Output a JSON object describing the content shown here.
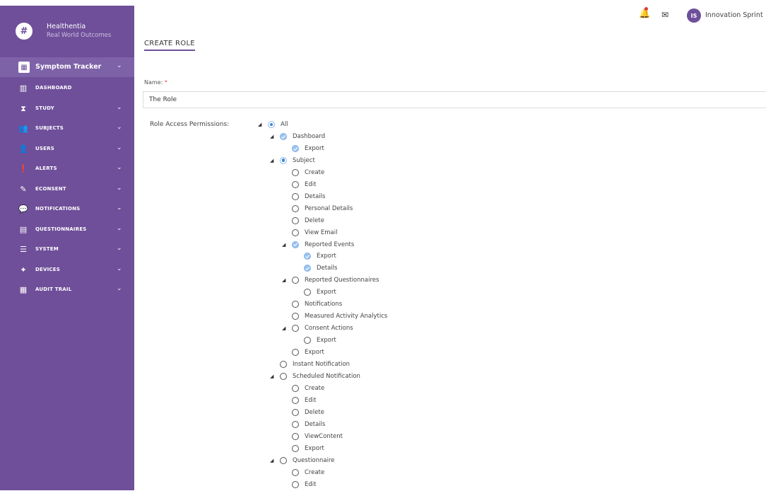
{
  "sidebar": {
    "brand_logo": "#",
    "brand_name": "Healthentia",
    "brand_sub": "Real World Outcomes",
    "module": {
      "label": "Symptom Tracker",
      "icon": "grid-icon"
    },
    "items": [
      {
        "label": "DASHBOARD",
        "icon": "bar-chart-icon",
        "chevron": false
      },
      {
        "label": "STUDY",
        "icon": "hourglass-icon",
        "chevron": true
      },
      {
        "label": "SUBJECTS",
        "icon": "users-icon",
        "chevron": true
      },
      {
        "label": "USERS",
        "icon": "user-icon",
        "chevron": true
      },
      {
        "label": "ALERTS",
        "icon": "alert-icon",
        "chevron": true
      },
      {
        "label": "ECONSENT",
        "icon": "pencil-icon",
        "chevron": true
      },
      {
        "label": "NOTIFICATIONS",
        "icon": "chat-icon",
        "chevron": true
      },
      {
        "label": "QUESTIONNAIRES",
        "icon": "clipboard-icon",
        "chevron": true
      },
      {
        "label": "SYSTEM",
        "icon": "sliders-icon",
        "chevron": true
      },
      {
        "label": "DEVICES",
        "icon": "plug-icon",
        "chevron": true
      },
      {
        "label": "AUDIT TRAIL",
        "icon": "audit-icon",
        "chevron": true
      }
    ]
  },
  "header": {
    "user_initials": "IS",
    "user_name": "Innovation Sprint"
  },
  "main": {
    "title": "CREATE ROLE",
    "name_label": "Name:",
    "name_required": "*",
    "name_value": "The Role",
    "permissions_label": "Role Access Permissions:"
  },
  "tree": [
    {
      "label": "All",
      "level": 0,
      "state": "partial",
      "expandable": true
    },
    {
      "label": "Dashboard",
      "level": 1,
      "state": "checked",
      "expandable": true
    },
    {
      "label": "Export",
      "level": 2,
      "state": "checked",
      "expandable": false
    },
    {
      "label": "Subject",
      "level": 1,
      "state": "partial",
      "expandable": true
    },
    {
      "label": "Create",
      "level": 2,
      "state": "unchecked",
      "expandable": false
    },
    {
      "label": "Edit",
      "level": 2,
      "state": "unchecked",
      "expandable": false
    },
    {
      "label": "Details",
      "level": 2,
      "state": "unchecked",
      "expandable": false
    },
    {
      "label": "Personal Details",
      "level": 2,
      "state": "unchecked",
      "expandable": false
    },
    {
      "label": "Delete",
      "level": 2,
      "state": "unchecked",
      "expandable": false
    },
    {
      "label": "View Email",
      "level": 2,
      "state": "unchecked",
      "expandable": false
    },
    {
      "label": "Reported Events",
      "level": 2,
      "state": "checked",
      "expandable": true
    },
    {
      "label": "Export",
      "level": 3,
      "state": "checked",
      "expandable": false
    },
    {
      "label": "Details",
      "level": 3,
      "state": "checked",
      "expandable": false
    },
    {
      "label": "Reported Questionnaires",
      "level": 2,
      "state": "unchecked",
      "expandable": true
    },
    {
      "label": "Export",
      "level": 3,
      "state": "unchecked",
      "expandable": false
    },
    {
      "label": "Notifications",
      "level": 2,
      "state": "unchecked",
      "expandable": false
    },
    {
      "label": "Measured Activity Analytics",
      "level": 2,
      "state": "unchecked",
      "expandable": false
    },
    {
      "label": "Consent Actions",
      "level": 2,
      "state": "unchecked",
      "expandable": true
    },
    {
      "label": "Export",
      "level": 3,
      "state": "unchecked",
      "expandable": false
    },
    {
      "label": "Export",
      "level": 2,
      "state": "unchecked",
      "expandable": false
    },
    {
      "label": "Instant Notification",
      "level": 1,
      "state": "unchecked",
      "expandable": false
    },
    {
      "label": "Scheduled Notification",
      "level": 1,
      "state": "unchecked",
      "expandable": true
    },
    {
      "label": "Create",
      "level": 2,
      "state": "unchecked",
      "expandable": false
    },
    {
      "label": "Edit",
      "level": 2,
      "state": "unchecked",
      "expandable": false
    },
    {
      "label": "Delete",
      "level": 2,
      "state": "unchecked",
      "expandable": false
    },
    {
      "label": "Details",
      "level": 2,
      "state": "unchecked",
      "expandable": false
    },
    {
      "label": "ViewContent",
      "level": 2,
      "state": "unchecked",
      "expandable": false
    },
    {
      "label": "Export",
      "level": 2,
      "state": "unchecked",
      "expandable": false
    },
    {
      "label": "Questionnaire",
      "level": 1,
      "state": "unchecked",
      "expandable": true
    },
    {
      "label": "Create",
      "level": 2,
      "state": "unchecked",
      "expandable": false
    },
    {
      "label": "Edit",
      "level": 2,
      "state": "unchecked",
      "expandable": false
    }
  ],
  "colors": {
    "sidebar_bg": "#6f4f9a",
    "accent": "#6f4f9a",
    "checked": "#9dc3ef",
    "required": "#d9534f"
  }
}
